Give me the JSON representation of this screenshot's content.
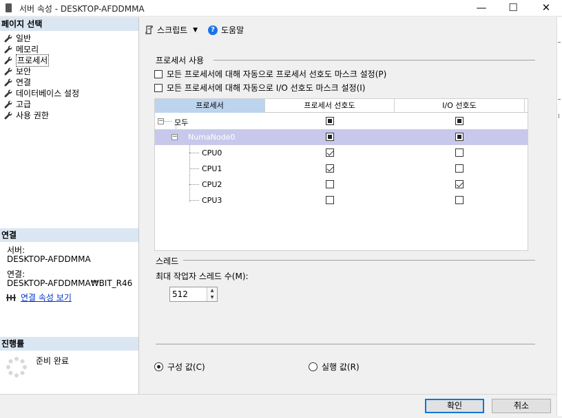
{
  "window": {
    "title": "서버 속성 - DESKTOP-AFDDMMA",
    "minimize": "—",
    "maximize": "☐",
    "close": "✕"
  },
  "left": {
    "pages_header": "페이지 선택",
    "pages": [
      {
        "label": "일반"
      },
      {
        "label": "메모리"
      },
      {
        "label": "프로세서"
      },
      {
        "label": "보안"
      },
      {
        "label": "연결"
      },
      {
        "label": "데이터베이스 설정"
      },
      {
        "label": "고급"
      },
      {
        "label": "사용 권한"
      }
    ],
    "connection_header": "연결",
    "server_label": "서버:",
    "server_value": "DESKTOP-AFDDMMA",
    "connection_label": "연결:",
    "connection_value": "DESKTOP-AFDDMMA₩BIT_R46",
    "view_link": "연결 속성 보기",
    "progress_header": "진행률",
    "progress_status": "준비 완료"
  },
  "toolbar": {
    "script_label": "스크립트",
    "help_label": "도움말"
  },
  "processor": {
    "section_title": "프로세서 사용",
    "auto_processor_affinity": "모든 프로세서에 대해 자동으로 프로세서 선호도 마스크 설정(P)",
    "auto_io_affinity": "모든 프로세서에 대해 자동으로 I/O 선호도 마스크 설정(I)",
    "columns": [
      "프로세서",
      "프로세서 선호도",
      "I/O 선호도"
    ],
    "rows": [
      {
        "name": "모두",
        "proc": "indeterminate",
        "io": "indeterminate"
      },
      {
        "name": "NumaNode0",
        "proc": "indeterminate",
        "io": "indeterminate"
      },
      {
        "name": "CPU0",
        "proc": "checked",
        "io": "unchecked"
      },
      {
        "name": "CPU1",
        "proc": "checked",
        "io": "unchecked"
      },
      {
        "name": "CPU2",
        "proc": "unchecked",
        "io": "checked"
      },
      {
        "name": "CPU3",
        "proc": "unchecked",
        "io": "unchecked"
      }
    ]
  },
  "threads": {
    "section_title": "스레드",
    "max_worker_label": "최대 작업자 스레드 수(M):",
    "max_worker_value": "512"
  },
  "values": {
    "configured_label": "구성 값(C)",
    "running_label": "실행 값(R)",
    "selected": "configured"
  },
  "buttons": {
    "ok": "확인",
    "cancel": "취소"
  },
  "scrollbar_glyph": "I"
}
